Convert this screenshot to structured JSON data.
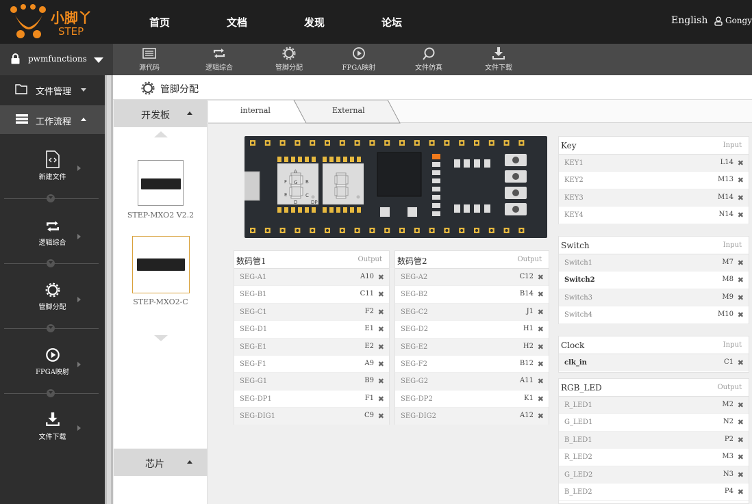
{
  "header": {
    "logo_cn": "小脚丫",
    "logo_en": "STEP",
    "nav": [
      "首页",
      "文档",
      "发现",
      "论坛"
    ],
    "lang": "English",
    "user": "Gongyu"
  },
  "project": {
    "name": "pwmfunctions"
  },
  "toolbar": [
    {
      "icon": "source-code-icon",
      "label": "源代码"
    },
    {
      "icon": "logic-synthesis-icon",
      "label": "逻辑综合"
    },
    {
      "icon": "gear-icon",
      "label": "管脚分配"
    },
    {
      "icon": "play-icon",
      "label": "FPGA映射"
    },
    {
      "icon": "simulation-icon",
      "label": "文件仿真"
    },
    {
      "icon": "download-icon",
      "label": "文件下载"
    }
  ],
  "sidebar": {
    "file_mgmt": "文件管理",
    "workflow": "工作流程",
    "flow": [
      {
        "icon": "new-file-icon",
        "label": "新建文件"
      },
      {
        "icon": "logic-synthesis-icon",
        "label": "逻辑综合"
      },
      {
        "icon": "gear-icon",
        "label": "管脚分配"
      },
      {
        "icon": "play-icon",
        "label": "FPGA映射"
      },
      {
        "icon": "download-icon",
        "label": "文件下载"
      }
    ]
  },
  "main": {
    "title": "管脚分配"
  },
  "board_panel": {
    "head": "开发板",
    "boards": [
      "STEP-MXO2 V2.2",
      "STEP-MXO2-C"
    ],
    "chip_head": "芯片"
  },
  "tabs": {
    "internal": "internal",
    "external": "External"
  },
  "pcb": {
    "seg_letters": {
      "a": "A",
      "b": "B",
      "c": "C",
      "d": "D",
      "e": "E",
      "f": "F",
      "g": "G",
      "dp": "DP"
    }
  },
  "panels": {
    "seg1": {
      "title": "数码管1",
      "io": "Output",
      "rows": [
        [
          "SEG-A1",
          "A10"
        ],
        [
          "SEG-B1",
          "C11"
        ],
        [
          "SEG-C1",
          "F2"
        ],
        [
          "SEG-D1",
          "E1"
        ],
        [
          "SEG-E1",
          "E2"
        ],
        [
          "SEG-F1",
          "A9"
        ],
        [
          "SEG-G1",
          "B9"
        ],
        [
          "SEG-DP1",
          "F1"
        ],
        [
          "SEG-DIG1",
          "C9"
        ]
      ]
    },
    "seg2": {
      "title": "数码管2",
      "io": "Output",
      "rows": [
        [
          "SEG-A2",
          "C12"
        ],
        [
          "SEG-B2",
          "B14"
        ],
        [
          "SEG-C2",
          "J1"
        ],
        [
          "SEG-D2",
          "H1"
        ],
        [
          "SEG-E2",
          "H2"
        ],
        [
          "SEG-F2",
          "B12"
        ],
        [
          "SEG-G2",
          "A11"
        ],
        [
          "SEG-DP2",
          "K1"
        ],
        [
          "SEG-DIG2",
          "A12"
        ]
      ]
    },
    "key": {
      "title": "Key",
      "io": "Input",
      "rows": [
        [
          "KEY1",
          "L14"
        ],
        [
          "KEY2",
          "M13"
        ],
        [
          "KEY3",
          "M14"
        ],
        [
          "KEY4",
          "N14"
        ]
      ]
    },
    "switch": {
      "title": "Switch",
      "io": "Input",
      "rows": [
        [
          "Switch1",
          "M7"
        ],
        [
          "Switch2",
          "M8"
        ],
        [
          "Switch3",
          "M9"
        ],
        [
          "Switch4",
          "M10"
        ]
      ]
    },
    "clock": {
      "title": "Clock",
      "io": "Input",
      "rows": [
        [
          "clk_in",
          "C1"
        ]
      ]
    },
    "rgb": {
      "title": "RGB_LED",
      "io": "Output",
      "rows": [
        [
          "R_LED1",
          "M2"
        ],
        [
          "G_LED1",
          "N2"
        ],
        [
          "B_LED1",
          "P2"
        ],
        [
          "R_LED2",
          "M3"
        ],
        [
          "G_LED2",
          "N3"
        ],
        [
          "B_LED2",
          "P4"
        ]
      ]
    }
  },
  "remove_glyph": "✖",
  "colors": {
    "accent": "#f08a1c",
    "topbar": "#1f1f1f",
    "pcb": "#2a2e33",
    "pad": "#e7b93f"
  }
}
